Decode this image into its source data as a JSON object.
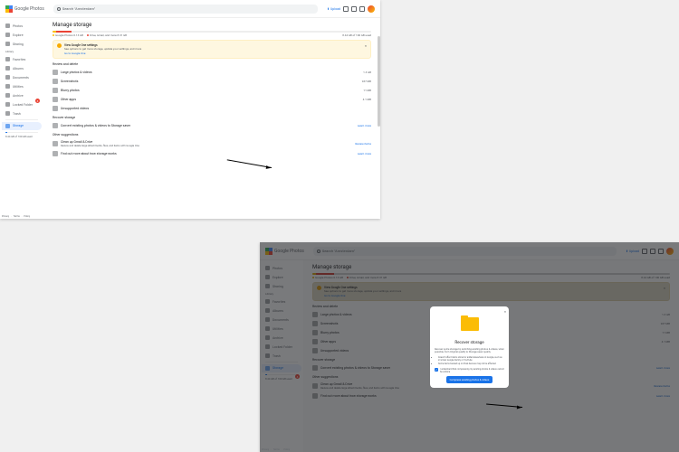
{
  "app_name": "Google Photos",
  "search_placeholder": "Search \"Amsterdam\"",
  "upload_label": "Upload",
  "sidebar": {
    "items": [
      {
        "label": "Photos"
      },
      {
        "label": "Explore"
      },
      {
        "label": "Sharing"
      },
      {
        "label": "Library"
      },
      {
        "label": "Favorites"
      },
      {
        "label": "Albums"
      },
      {
        "label": "Documents"
      },
      {
        "label": "Utilities"
      },
      {
        "label": "Archive"
      },
      {
        "label": "Locked Folder"
      },
      {
        "label": "Trash"
      }
    ],
    "storage_label": "Storage",
    "storage_text": "8.44 GB of 100 GB used",
    "badge": "3"
  },
  "main": {
    "title": "Manage storage",
    "usage": {
      "photos": "Google Photos 0.13 GB",
      "drive": "Drive, Gmail, and more 8.31 GB",
      "total": "8.44 GB of 100 GB used"
    },
    "alert": {
      "title": "View Google One settings",
      "text": "See options to get more storage, update your settings, and more",
      "link": "Go to Google One"
    },
    "review_header": "Review and delete",
    "review_items": [
      {
        "label": "Large photos & videos",
        "value": "1.3 GB"
      },
      {
        "label": "Screenshots",
        "value": "937 MB"
      },
      {
        "label": "Blurry photos",
        "value": "11 MB"
      },
      {
        "label": "Other apps",
        "value": "4.1 MB"
      },
      {
        "label": "Unsupported videos",
        "value": ""
      }
    ],
    "recover_header": "Recover storage",
    "recover_item": {
      "label": "Convert existing photos & videos to Storage saver",
      "link": "Learn more"
    },
    "other_header": "Other suggestions",
    "other_items": [
      {
        "label": "Clean up Gmail & Drive",
        "sub": "Review and delete large attachments, files, and items with Google One",
        "link": "Review items"
      },
      {
        "label": "Find out more about how storage works",
        "link": "Learn more"
      }
    ]
  },
  "modal": {
    "title": "Recover storage",
    "text": "Recover some storage by switching existing photos & videos, when possible, from Original quality to Storage saver quality",
    "list": [
      "Doesn't affect items stored or added elsewhere on Google, such as in Gmail, Google Family or YouTube",
      "Some items backed up on Pixel devices may not be affected"
    ],
    "checkbox": "I understand that compressing my existing photos & videos cannot be undone",
    "button": "Compress existing photos & videos"
  },
  "footer": [
    "Privacy",
    "Terms",
    "Policy"
  ]
}
